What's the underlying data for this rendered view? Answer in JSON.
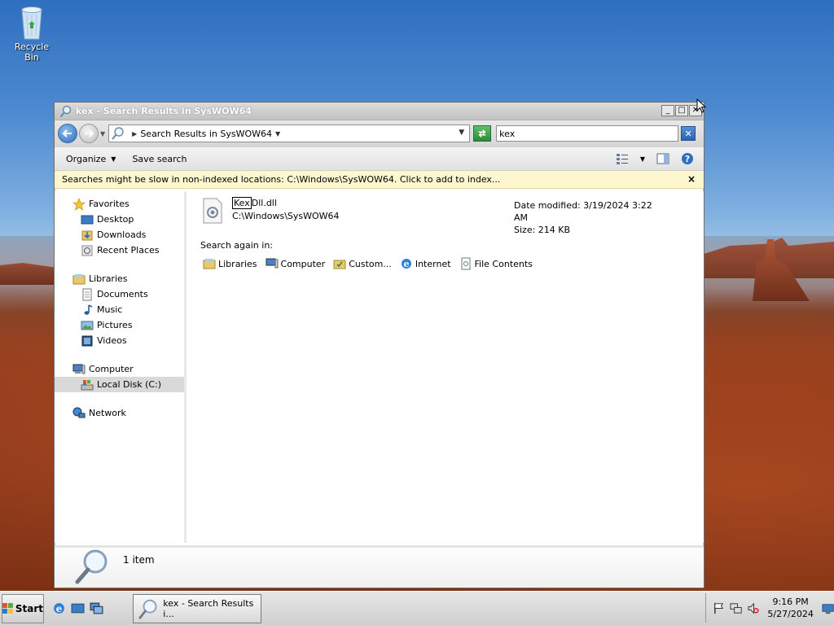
{
  "desktop": {
    "recycle_bin_label": "Recycle Bin"
  },
  "window": {
    "title": "kex - Search Results in SysWOW64",
    "buttons": {
      "minimize": "_",
      "maximize": "□",
      "close": "✕"
    },
    "address": {
      "path_label": "Search Results in SysWOW64"
    },
    "search": {
      "value": "kex"
    },
    "toolbar": {
      "organize": "Organize",
      "save_search": "Save search"
    },
    "infobar": {
      "message": "Searches might be slow in non-indexed locations: C:\\Windows\\SysWOW64. Click to add to index...",
      "close": "×"
    },
    "nav": {
      "favorites": {
        "label": "Favorites",
        "items": [
          "Desktop",
          "Downloads",
          "Recent Places"
        ]
      },
      "libraries": {
        "label": "Libraries",
        "items": [
          "Documents",
          "Music",
          "Pictures",
          "Videos"
        ]
      },
      "computer": {
        "label": "Computer",
        "items": [
          "Local Disk (C:)"
        ]
      },
      "network": {
        "label": "Network"
      }
    },
    "result": {
      "name_highlight": "Kex",
      "name_rest": "Dll.dll",
      "path": "C:\\Windows\\SysWOW64",
      "date_modified": "Date modified: 3/19/2024 3:22 AM",
      "size": "Size: 214 KB"
    },
    "search_again": {
      "label": "Search again in:",
      "items": [
        "Libraries",
        "Computer",
        "Custom...",
        "Internet",
        "File Contents"
      ]
    },
    "details": {
      "count": "1 item"
    }
  },
  "taskbar": {
    "start": "Start",
    "task_label": "kex - Search Results i...",
    "clock_time": "9:16 PM",
    "clock_date": "5/27/2024"
  }
}
